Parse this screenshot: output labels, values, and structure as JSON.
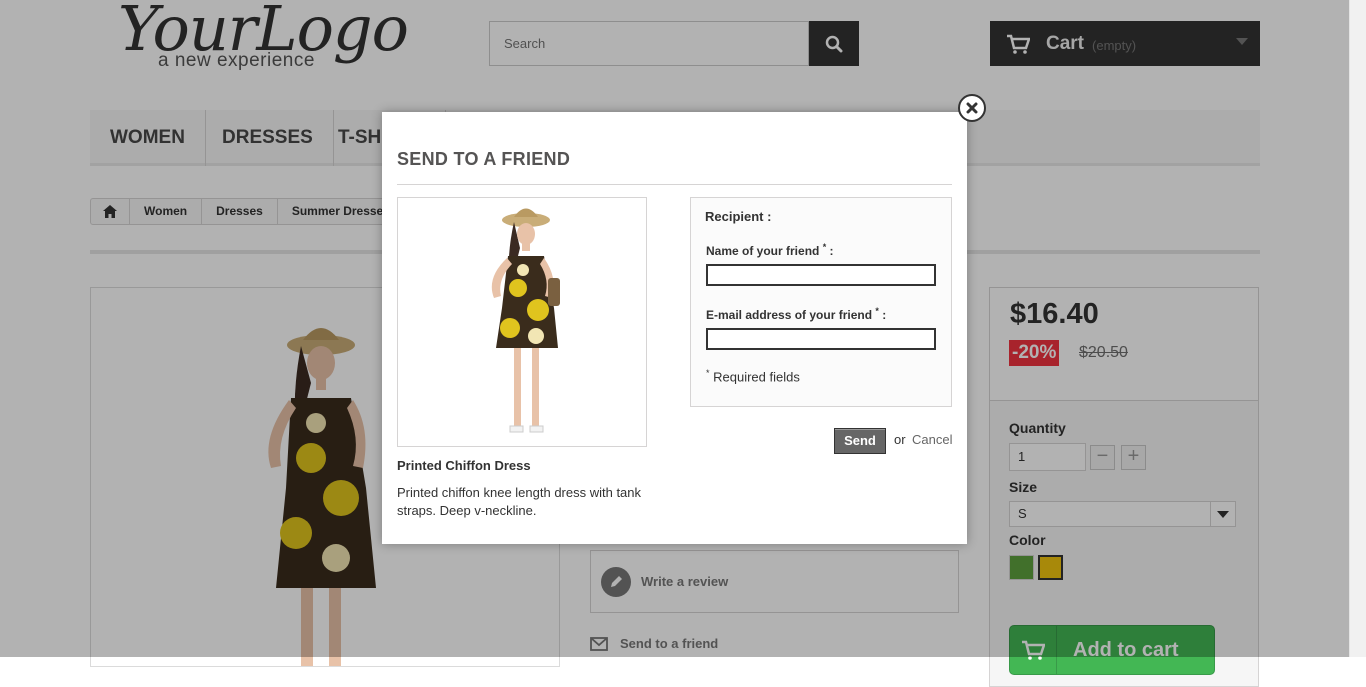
{
  "header": {
    "logo_main": "YourLogo",
    "logo_tagline": "a new experience",
    "search_placeholder": "Search",
    "cart_label": "Cart",
    "cart_status": "(empty)"
  },
  "menu": {
    "items": [
      {
        "label": "WOMEN"
      },
      {
        "label": "DRESSES"
      },
      {
        "label": "T-SHIRTS"
      }
    ]
  },
  "breadcrumb": {
    "items": [
      "Women",
      "Dresses",
      "Summer Dresses"
    ]
  },
  "product": {
    "price": "$16.40",
    "reduction": "-20%",
    "old_price": "$20.50",
    "quantity_label": "Quantity",
    "quantity_value": "1",
    "size_label": "Size",
    "size_value": "S",
    "color_label": "Color",
    "colors": [
      "#5ea13e",
      "#f1c40f"
    ],
    "review_label": "Write a review",
    "send_friend_label": "Send to a friend",
    "add_to_cart_label": "Add to cart"
  },
  "modal": {
    "title": "SEND TO A FRIEND",
    "product_name": "Printed Chiffon Dress",
    "product_description": "Printed chiffon knee length dress with tank straps. Deep v-neckline.",
    "recipient_heading": "Recipient :",
    "name_label": "Name of your friend",
    "email_label": "E-mail address of your friend",
    "required_asterisk": "*",
    "label_suffix": " :",
    "name_value": "",
    "email_value": "",
    "required_note": "Required fields",
    "send_label": "Send",
    "or_text": "or",
    "cancel_label": "Cancel"
  }
}
